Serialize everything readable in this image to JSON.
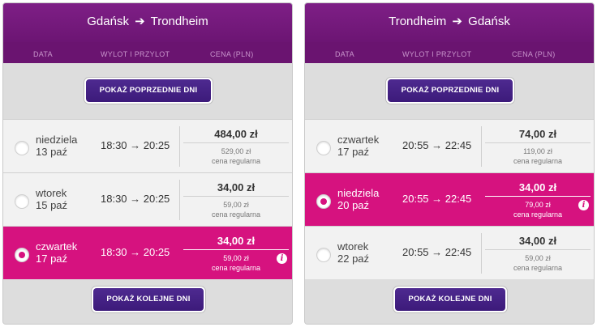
{
  "columns": {
    "date": "DATA",
    "times": "WYLOT I PRZYLOT",
    "price": "CENA (PLN)"
  },
  "prev_label": "POKAŻ POPRZEDNIE DNI",
  "next_label": "POKAŻ KOLEJNE DNI",
  "info_glyph": "i",
  "accent_color": "#d6127f",
  "header_color": "#7e1f86",
  "button_color": "#4a2689",
  "outbound": {
    "from": "Gdańsk",
    "arrow": "➔",
    "to": "Trondheim",
    "flights": [
      {
        "day": "niedziela",
        "date": "13 paź",
        "times": "18:30 → 20:25",
        "price": "484,00 zł",
        "regular_price": "529,00 zł",
        "regular_label": "cena regularna",
        "selected": false
      },
      {
        "day": "wtorek",
        "date": "15 paź",
        "times": "18:30 → 20:25",
        "price": "34,00 zł",
        "regular_price": "59,00 zł",
        "regular_label": "cena regularna",
        "selected": false
      },
      {
        "day": "czwartek",
        "date": "17 paź",
        "times": "18:30 → 20:25",
        "price": "34,00 zł",
        "regular_price": "59,00 zł",
        "regular_label": "cena regularna",
        "selected": true
      }
    ]
  },
  "return": {
    "from": "Trondheim",
    "arrow": "➔",
    "to": "Gdańsk",
    "flights": [
      {
        "day": "czwartek",
        "date": "17 paź",
        "times": "20:55 → 22:45",
        "price": "74,00 zł",
        "regular_price": "119,00 zł",
        "regular_label": "cena regularna",
        "selected": false
      },
      {
        "day": "niedziela",
        "date": "20 paź",
        "times": "20:55 → 22:45",
        "price": "34,00 zł",
        "regular_price": "79,00 zł",
        "regular_label": "cena regularna",
        "selected": true
      },
      {
        "day": "wtorek",
        "date": "22 paź",
        "times": "20:55 → 22:45",
        "price": "34,00 zł",
        "regular_price": "59,00 zł",
        "regular_label": "cena regularna",
        "selected": false
      }
    ]
  }
}
